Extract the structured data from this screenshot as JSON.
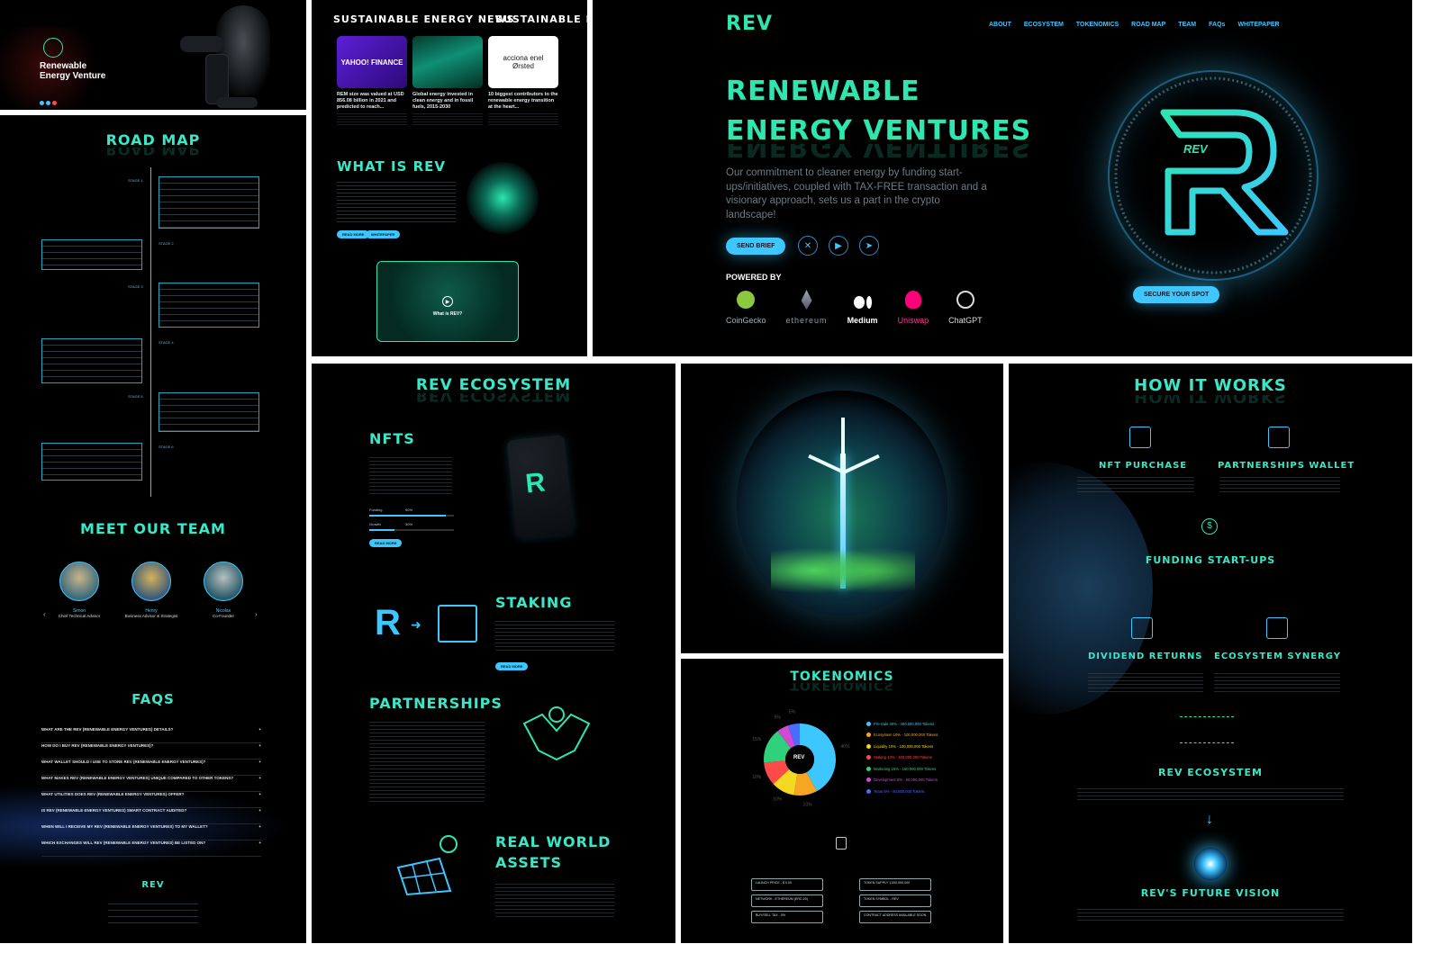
{
  "hero_mini": {
    "title_line1": "Renewable",
    "title_line2": "Energy Venture"
  },
  "news": {
    "title": "SUSTAINABLE ENERGY NEWS",
    "title_dup": "SUSTAINABLE ENER",
    "cards": [
      {
        "brand": "YAHOO! FINANCE",
        "headline": "REM size was valued at USD 856.08 billion in 2021 and predicted to reach..."
      },
      {
        "brand": "",
        "headline": "Global energy invested in clean energy and in fossil fuels, 2015-2030"
      },
      {
        "brand": "acciona  enel  Ørsted",
        "headline": "10 biggest contributors to the renewable energy transition at the heart..."
      }
    ]
  },
  "what_is_rev": {
    "title": "WHAT IS REV",
    "btn1": "READ MORE",
    "btn2": "WHITEPAPER",
    "video_label": "What is REV?"
  },
  "site": {
    "logo": "REV",
    "nav": [
      "ABOUT",
      "ECOSYSTEM",
      "TOKENOMICS",
      "ROAD MAP",
      "TEAM",
      "FAQs",
      "WHITEPAPER"
    ],
    "hero_line1": "RENEWABLE",
    "hero_line2": "ENERGY VENTURES",
    "hero_copy": "Our commitment to cleaner energy by funding start-ups/initiatives, coupled with TAX-FREE transaction and a visionary approach, sets us a part in the crypto landscape!",
    "send_brief": "SEND BRIEF",
    "secure_spot": "SECURE YOUR SPOT",
    "powered_by": "POWERED BY",
    "partners": [
      "CoinGecko",
      "ethereum",
      "Medium",
      "Uniswap",
      "ChatGPT"
    ],
    "emblem_text": "REV"
  },
  "roadmap": {
    "title": "ROAD MAP",
    "stages": [
      "STAGE 1",
      "STAGE 2",
      "STAGE 3",
      "STAGE 4",
      "STAGE 5",
      "STAGE 6"
    ]
  },
  "team": {
    "title": "MEET OUR TEAM",
    "members": [
      {
        "name": "Simon",
        "role": "Chief Technical Advisor"
      },
      {
        "name": "Henry",
        "role": "Business Advisor & Strategist"
      },
      {
        "name": "Nicolas",
        "role": "Co-Founder"
      }
    ]
  },
  "faqs": {
    "title": "FAQs",
    "items": [
      "WHAT ARE THE REV (RENEWABLE ENERGY VENTURES) DETAILS?",
      "HOW DO I BUY REV (RENEWABLE ENERGY VENTURES)?",
      "WHAT WALLET SHOULD I USE TO STORE REV (RENEWABLE ENERGY VENTURES)?",
      "WHAT MAKES REV (RENEWABLE ENERGY VENTURES) UNIQUE COMPARED TO OTHER TOKENS?",
      "WHAT UTILITIES DOES REV (RENEWABLE ENERGY VENTURES) OFFER?",
      "IS REV (RENEWABLE ENERGY VENTURES) SMART CONTRACT AUDITED?",
      "WHEN WILL I RECEIVE MY REV (RENEWABLE ENERGY VENTURES) TO MY WALLET?",
      "WHICH EXCHANGES WILL REV (RENEWABLE ENERGY VENTURES) BE LISTED ON?"
    ],
    "footer_logo": "REV"
  },
  "ecosystem": {
    "title": "REV ECOSYSTEM",
    "nfts": "NFTs",
    "staking": "STAKING",
    "partnerships": "PARTNERSHIPS",
    "rwa_line1": "REAL WORLD",
    "rwa_line2": "ASSETS",
    "bar1": "Funding",
    "bar2": "Growth",
    "bar1_pct": "90%",
    "bar2_pct": "30%",
    "btn": "READ MORE"
  },
  "tokenomics": {
    "title": "TOKENOMICS",
    "center": "REV",
    "legend": [
      {
        "label": "Pre-Sale 40% - 400,000,000 Tokens",
        "color": "#3ec7ff"
      },
      {
        "label": "Ecosystem 10% - 100,000,000 Tokens",
        "color": "#f5a623"
      },
      {
        "label": "Liquidity 10% - 100,000,000 Tokens",
        "color": "#f5d823"
      },
      {
        "label": "Staking 10% - 100,000,000 Tokens",
        "color": "#ff4a4a"
      },
      {
        "label": "Marketing 15% - 150,000,000 Tokens",
        "color": "#2fd27a"
      },
      {
        "label": "Development 5% - 50,000,000 Tokens",
        "color": "#d24ad2"
      },
      {
        "label": "Team 5% - 50,000,000 Tokens",
        "color": "#4a6cff"
      }
    ],
    "slice_labels": [
      "40%",
      "10%",
      "10%",
      "10%",
      "15%",
      "5%",
      "5%"
    ],
    "info_left": [
      "LAUNCH PRICE - $ 0.00",
      "NETWORK - ETHEREUM (ERC-20)",
      "BUY/SELL TAX - 0%"
    ],
    "info_right": [
      "TOKEN SUPPLY 1,000,000,000",
      "TOKEN SYMBOL - REV",
      "CONTRACT ADDRESS AVAILABLE SOON"
    ]
  },
  "how": {
    "title": "HOW IT WORKS",
    "nft": "NFT PURCHASE",
    "wallet": "PARTNERSHIPS WALLET",
    "funding": "FUNDING START-UPS",
    "dividend": "DIVIDEND RETURNS",
    "synergy": "ECOSYSTEM SYNERGY",
    "eco": "REV ECOSYSTEM",
    "vision": "REV's FUTURE VISION"
  }
}
